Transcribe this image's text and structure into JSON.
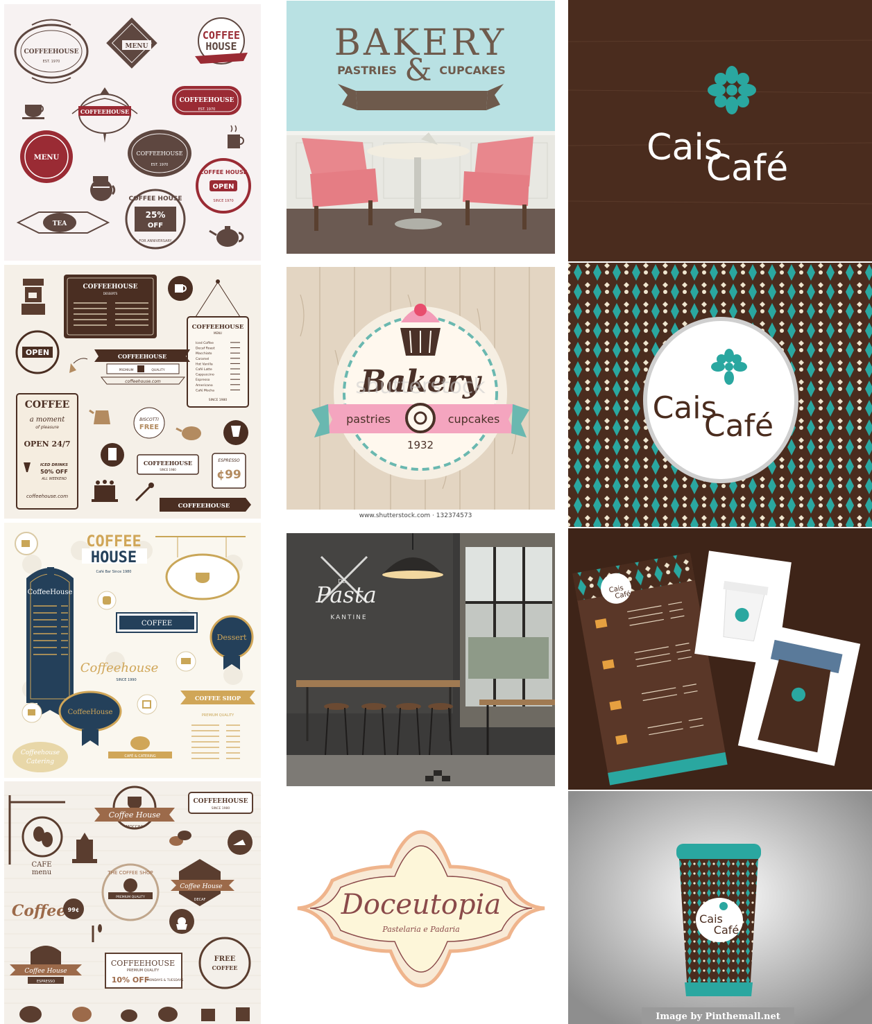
{
  "colors": {
    "cream": "#f5efe6",
    "brown": "#6b5347",
    "maroon": "#9a2b34",
    "navy": "#24405a",
    "teal": "#2aa7a0",
    "pink": "#e37a9a",
    "dark_wood": "#3b2418",
    "sky": "#b7e0e2"
  },
  "tiles": {
    "badges1": {
      "coffeehouse_a": "COFFEEHOUSE",
      "est_a": "EST. 1970",
      "menu_a": "MENU",
      "coffee_house_stamp_1": "COFFEE",
      "coffee_house_stamp_2": "HOUSE",
      "coffeehouse_b": "COFFEEHOUSE",
      "coffeehouse_c": "COFFEEHOUSE",
      "est_c": "EST. 1970",
      "menu_b": "MENU",
      "coffeehouse_d": "COFFEEHOUSE",
      "est_d": "EST. 1970",
      "coffee_house_open": "COFFEE HOUSE",
      "open": "OPEN",
      "since": "SINCE 1970",
      "tea": "TEA",
      "coffee_house_e": "COFFEE HOUSE",
      "pct": "25%",
      "off": "OFF",
      "anniv": "FOR ANNIVERSARY"
    },
    "bakery_wall": {
      "title": "BAKERY",
      "left": "PASTRIES",
      "amp": "&",
      "right": "CUPCAKES"
    },
    "cais_logo": {
      "word1": "Cais",
      "word2": "Café"
    },
    "coffee_menu": {
      "board_title": "COFFEEHOUSE",
      "board_sub": "DESSERTS",
      "open_badge": "OPEN",
      "coffeehouse_ribbon": "COFFEEHOUSE",
      "premium": "PREMIUM",
      "quality": "QUALITY",
      "url": "coffeehouse.com",
      "hang_title": "COFFEEHOUSE",
      "hang_sub": "MENU",
      "hang_items": [
        "Iced Coffee",
        "Decaf Roast",
        "Macchiato",
        "Caramel",
        "Hot Vanilla",
        "Café Latte",
        "Cappuccino",
        "Espresso",
        "Americano",
        "Café Mocha"
      ],
      "since_1980": "SINCE 1980",
      "coffee": "COFFEE",
      "moment": "a moment",
      "pleasure": "of pleasure",
      "open247": "OPEN 24/7",
      "iced_drinks": "ICED DRINKS",
      "pct50": "50% OFF",
      "weekend": "ALL WEEKEND",
      "url2": "coffeehouse.com",
      "biscotti": "BISCOTTI",
      "free": "FREE",
      "espresso": "ESPRESSO",
      "price": "¢99",
      "coffeehouse_small": "COFFEEHOUSE",
      "since_small": "SINCE 1980",
      "coffeehouse_arrow": "COFFEEHOUSE"
    },
    "bakery_badge": {
      "title": "Bakery",
      "left": "pastries",
      "right": "cupcakes",
      "year": "1932",
      "watermark": "shutterstock",
      "caption": "www.shutterstock.com · 132374573"
    },
    "cais_pattern": {
      "word1": "Cais",
      "word2": "Café"
    },
    "coffee_navy": {
      "coffee": "COFFEE",
      "house": "HOUSE",
      "sub": "Café Bar Since 1980",
      "coffeehouse_tall": "CoffeeHouse",
      "coffee_banner": "COFFEE",
      "dessert": "Dessert",
      "script": "Coffeehouse",
      "since": "SINCE 1990",
      "coffeehouse_oval": "CoffeeHouse",
      "coffee_shop": "COFFEE SHOP",
      "premium": "PREMIUM QUALITY",
      "catering1": "Coffeehouse",
      "catering2": "Catering",
      "cafe_catering": "CAFÉ & CATERING"
    },
    "pasta": {
      "de": "DE",
      "pasta": "Pasta",
      "kantine": "KANTINE"
    },
    "cais_menu": {
      "word1": "Cais",
      "word2": "Café"
    },
    "coffee_vintage": {
      "coffee_house_a": "Coffee House",
      "moccha": "MOCCHA",
      "coffeehouse_box": "COFFEEHOUSE",
      "since_box": "SINCE 1980",
      "cafe": "CAFE",
      "menu": "menu",
      "the_coffee_shop": "THE COFFEE SHOP",
      "premium": "PREMIUM QUALITY",
      "coffee_house_b": "Coffee House",
      "decaf": "DECAF",
      "coffee_script": "Coffee",
      "price": "99¢",
      "coffee_house_c": "Coffee House",
      "espresso": "ESPRESSO",
      "coffeehouse_sign": "COFFEEHOUSE",
      "premium2": "PREMIUM QUALITY",
      "pct10": "10% OFF",
      "mondays": "MONDAYS & TUESDAYS",
      "free": "FREE",
      "free_coffee": "COFFEE"
    },
    "doceutopia": {
      "title": "Doceutopia",
      "sub": "Pastelaria e Padaria"
    },
    "cais_cup": {
      "word1": "Cais",
      "word2": "Café",
      "credit": "Image by Pinthemall.net"
    }
  }
}
